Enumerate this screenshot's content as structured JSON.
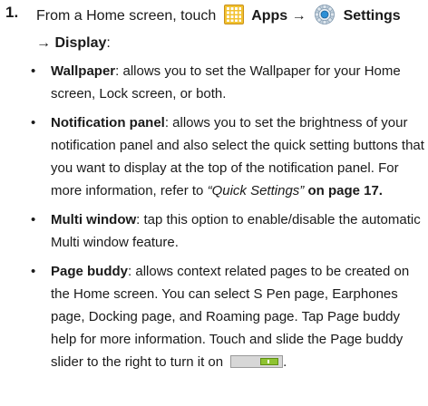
{
  "step": {
    "number": "1.",
    "line1_prefix": "From a Home screen, touch",
    "apps_label": "Apps",
    "arrow1": "→",
    "settings_label": "Settings",
    "arrow2": "→",
    "display_label": "Display",
    "line2_suffix": ":"
  },
  "icons": {
    "apps": "apps-grid-icon",
    "settings": "settings-gear-icon",
    "toggle": "page-buddy-toggle-on"
  },
  "bullets": [
    {
      "title": "Wallpaper",
      "lines": [
        ": allows you to set the Wallpaper for your Home",
        "screen, Lock screen, or both."
      ]
    },
    {
      "title": "Notification panel",
      "lines": [
        ": allows you to set the brightness of your",
        "notification panel and also select the quick setting buttons that",
        "you want to display at the top of the notification panel. For",
        "more information, refer to "
      ],
      "ref_text": "“Quick Settings”",
      "ref_page": " on page 17."
    },
    {
      "title": "Multi window",
      "lines": [
        ": tap this option to enable/disable the automatic",
        "Multi window feature."
      ]
    },
    {
      "title": "Page buddy",
      "lines": [
        ": allows context related pages to be created on",
        "the Home screen. You can select S Pen page, Earphones",
        "page, Docking page, and Roaming page. Tap Page buddy",
        "help for more information. Touch and slide the Page buddy",
        "slider to the right to turn it on"
      ],
      "end_punct": "."
    }
  ],
  "bullet_symbol": "•"
}
